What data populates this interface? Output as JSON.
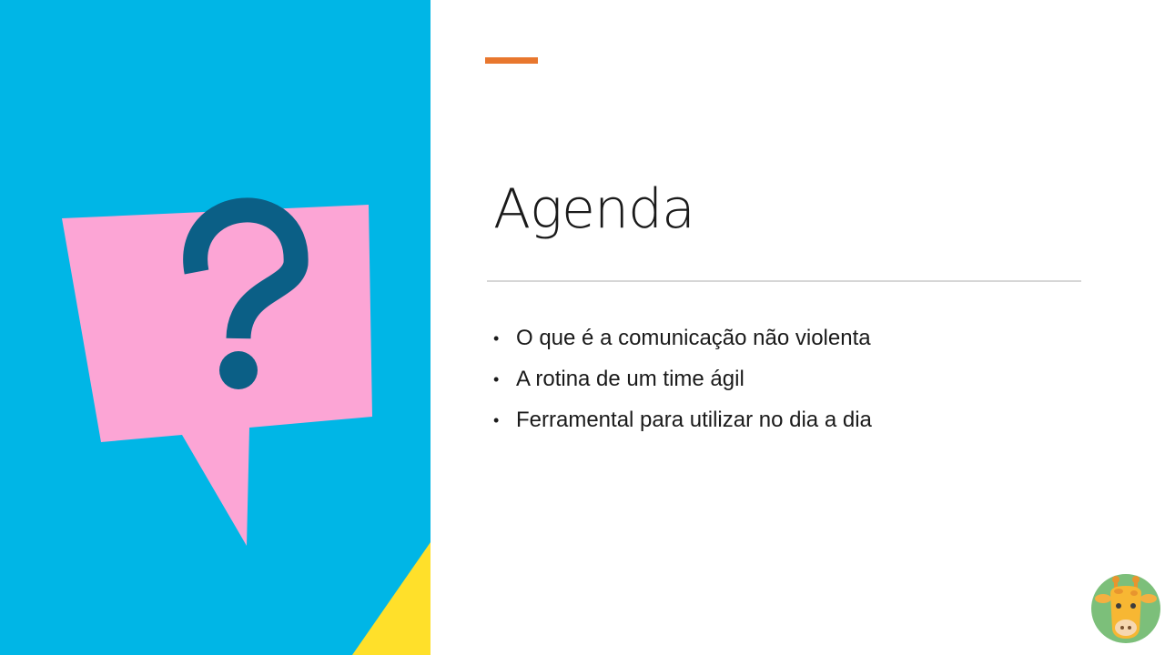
{
  "slide": {
    "title": "Agenda",
    "accent_color": "#e8772e",
    "panel_color": "#00b6e6",
    "bullet_glyph": "•",
    "items": [
      {
        "label": "O que é a comunicação não violenta"
      },
      {
        "label": "A rotina de um time ágil"
      },
      {
        "label": "Ferramental para utilizar no dia a dia"
      }
    ]
  },
  "illustration": {
    "icon": "question-speech-bubble-icon",
    "bubble_color": "#fca5d5",
    "question_mark_color": "#0b5f86",
    "corner_triangle_color": "#ffe02a"
  },
  "avatar": {
    "icon": "giraffe-icon",
    "background_color": "#7cbf7a"
  }
}
